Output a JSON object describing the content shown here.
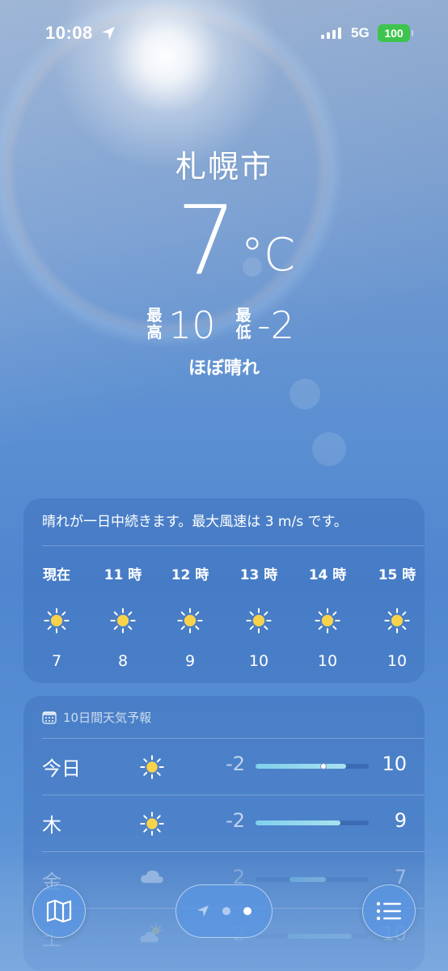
{
  "status_bar": {
    "time": "10:08",
    "network": "5G",
    "battery": "100",
    "battery_color": "#3ec44e"
  },
  "current": {
    "city": "札幌市",
    "temperature": "7",
    "unit": "°C",
    "high_label": "最高",
    "high": "10",
    "low_label": "最低",
    "low": "-2",
    "condition": "ほぼ晴れ"
  },
  "hourly": {
    "summary": "晴れが一日中続きます。最大風速は 3 m/s です。",
    "items": [
      {
        "label": "現在",
        "icon": "sun-icon",
        "temp": "7"
      },
      {
        "label": "11 時",
        "icon": "sun-icon",
        "temp": "8"
      },
      {
        "label": "12 時",
        "icon": "sun-icon",
        "temp": "9"
      },
      {
        "label": "13 時",
        "icon": "sun-icon",
        "temp": "10"
      },
      {
        "label": "14 時",
        "icon": "sun-icon",
        "temp": "10"
      },
      {
        "label": "15 時",
        "icon": "sun-icon",
        "temp": "10"
      }
    ]
  },
  "daily": {
    "header": "10日間天気予報",
    "header_icon": "calendar-icon",
    "days": [
      {
        "day": "今日",
        "icon": "sun-icon",
        "low": "-2",
        "high": "10",
        "bar_start": 0.0,
        "bar_end": 0.8,
        "current_marker": 0.6
      },
      {
        "day": "木",
        "icon": "sun-icon",
        "low": "-2",
        "high": "9",
        "bar_start": 0.0,
        "bar_end": 0.75
      },
      {
        "day": "金",
        "icon": "cloud-icon",
        "low": "2",
        "high": "7",
        "bar_start": 0.3,
        "bar_end": 0.62
      },
      {
        "day": "土",
        "icon": "partly-cloudy-icon",
        "low": "2",
        "high": "10",
        "bar_start": 0.28,
        "bar_end": 0.85
      }
    ]
  },
  "bottom_bar": {
    "map_icon": "map-icon",
    "location_icon": "location-arrow-icon",
    "list_icon": "list-icon"
  }
}
